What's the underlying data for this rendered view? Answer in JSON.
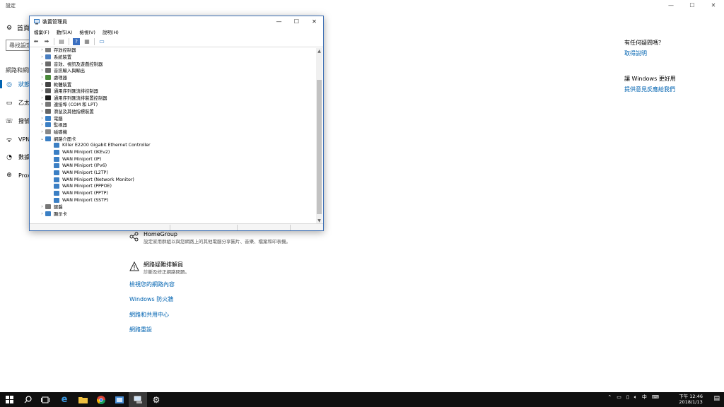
{
  "settings": {
    "window_title": "設定",
    "controls": {
      "minimize": "—",
      "maximize": "☐",
      "close": "✕"
    },
    "nav": {
      "home": "首頁",
      "search_placeholder": "尋找設定",
      "group_label": "網路和網際網路",
      "items": [
        {
          "label": "狀態",
          "icon": "status-icon"
        },
        {
          "label": "乙太網路",
          "icon": "ethernet-icon"
        },
        {
          "label": "撥號",
          "icon": "dialup-icon"
        },
        {
          "label": "VPN",
          "icon": "vpn-icon"
        },
        {
          "label": "數據使用量",
          "icon": "data-usage-icon"
        },
        {
          "label": "Proxy",
          "icon": "proxy-icon"
        }
      ]
    },
    "sidebar": {
      "question": "有任何疑問嗎？",
      "help_link": "取得說明",
      "improve_title": "讓 Windows 更好用",
      "feedback_link": "提供意見反應給我們"
    },
    "main": {
      "homegroup_title": "HomeGroup",
      "homegroup_desc": "設定家用群組以與您網路上的其他電腦分享圖片、音樂、檔案和印表機。",
      "troubleshoot_title": "網路疑難排解員",
      "troubleshoot_desc": "診斷及修正網路問題。",
      "links": [
        "檢視您的網路內容",
        "Windows 防火牆",
        "網路和共用中心",
        "網路重設"
      ]
    }
  },
  "device_manager": {
    "title": "裝置管理員",
    "controls": {
      "minimize": "—",
      "maximize": "☐",
      "close": "✕"
    },
    "menu": [
      "檔案(F)",
      "動作(A)",
      "檢視(V)",
      "說明(H)"
    ],
    "tree": [
      {
        "label": "存放控制器",
        "expanded": false,
        "icon_color": "#7a7a7a"
      },
      {
        "label": "系統裝置",
        "expanded": false,
        "icon_color": "#4a7fc1"
      },
      {
        "label": "音效、視訊及遊戲控制器",
        "expanded": false,
        "icon_color": "#6b6b6b"
      },
      {
        "label": "音訊輸入與輸出",
        "expanded": false,
        "icon_color": "#6b6b6b"
      },
      {
        "label": "處理器",
        "expanded": false,
        "icon_color": "#4a8a3a"
      },
      {
        "label": "軟體裝置",
        "expanded": false,
        "icon_color": "#444444"
      },
      {
        "label": "通用序列匯流排控制器",
        "expanded": false,
        "icon_color": "#555555"
      },
      {
        "label": "通用序列匯流排裝置控制器",
        "expanded": false,
        "icon_color": "#1a1a1a"
      },
      {
        "label": "連接埠 (COM 和 LPT)",
        "expanded": false,
        "icon_color": "#777777"
      },
      {
        "label": "滑鼠及其他指標裝置",
        "expanded": false,
        "icon_color": "#666666"
      },
      {
        "label": "電腦",
        "expanded": false,
        "icon_color": "#3b7fc4"
      },
      {
        "label": "監視器",
        "expanded": false,
        "icon_color": "#3b7fc4"
      },
      {
        "label": "磁碟機",
        "expanded": false,
        "icon_color": "#888888"
      },
      {
        "label": "網路介面卡",
        "expanded": true,
        "icon_color": "#3b7fc4"
      }
    ],
    "network_children": [
      "Killer E2200 Gigabit Ethernet Controller",
      "WAN Miniport (IKEv2)",
      "WAN Miniport (IP)",
      "WAN Miniport (IPv6)",
      "WAN Miniport (L2TP)",
      "WAN Miniport (Network Monitor)",
      "WAN Miniport (PPPOE)",
      "WAN Miniport (PPTP)",
      "WAN Miniport (SSTP)"
    ],
    "tree_after": [
      {
        "label": "鍵盤",
        "expanded": false,
        "icon_color": "#777777"
      },
      {
        "label": "顯示卡",
        "expanded": false,
        "icon_color": "#3b7fc4"
      }
    ]
  },
  "taskbar": {
    "time": "下午 12:46",
    "date": "2018/1/13",
    "ime": "中",
    "apps": [
      "start-icon",
      "search-icon",
      "task-view-icon",
      "edge-icon",
      "file-explorer-icon",
      "chrome-icon",
      "photos-icon",
      "device-manager-icon",
      "settings-icon"
    ]
  }
}
